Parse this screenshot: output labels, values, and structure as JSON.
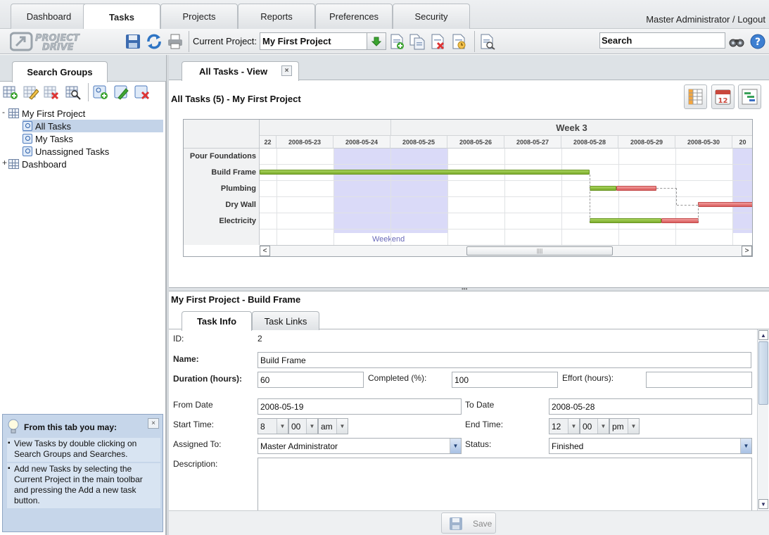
{
  "top_tabs": [
    "Dashboard",
    "Tasks",
    "Projects",
    "Reports",
    "Preferences",
    "Security"
  ],
  "user": {
    "link_text": "Master Administrator / Logout"
  },
  "brand": {
    "logo_line1": "PROJECT",
    "logo_line2": "DRIVE"
  },
  "toolbar": {
    "current_project_label": "Current Project:",
    "current_project_value": "My First Project",
    "search_value": "Search",
    "icons": [
      "save-icon",
      "refresh-icon",
      "print-icon",
      "add-task-icon",
      "copy-task-icon",
      "delete-task-icon",
      "schedule-task-icon",
      "report-icon",
      "binoculars-icon",
      "help-icon"
    ]
  },
  "left_panel": {
    "tab": "Search Groups",
    "tools": [
      "add-group-icon",
      "edit-group-icon",
      "delete-group-icon",
      "view-group-icon",
      "add-search-icon",
      "edit-search-icon",
      "delete-search-icon"
    ],
    "tree": [
      {
        "label": "My First Project",
        "toggle": "-"
      },
      {
        "label": "All Tasks"
      },
      {
        "label": "My Tasks"
      },
      {
        "label": "Unassigned Tasks"
      },
      {
        "label": "Dashboard",
        "toggle": "+"
      }
    ]
  },
  "tips": {
    "title": "From this tab you may:",
    "close": "×",
    "items": [
      "View Tasks by double clicking on Search Groups and Searches.",
      "Add new Tasks by selecting the Current Project in the main toolbar and pressing the Add a new task button."
    ]
  },
  "main_tab": {
    "label": "All Tasks - View",
    "close": "×"
  },
  "view": {
    "title": "All Tasks (5) - My First Project"
  },
  "gantt": {
    "week_label": "Week 3",
    "partial_left_date": "22",
    "dates": [
      "2008-05-23",
      "2008-05-24",
      "2008-05-25",
      "2008-05-26",
      "2008-05-27",
      "2008-05-28",
      "2008-05-29",
      "2008-05-30"
    ],
    "partial_right_date": "20",
    "tasks": [
      "Pour Foundations",
      "Build Frame",
      "Plumbing",
      "Dry Wall",
      "Electricity"
    ],
    "weekend_label": "Weekend",
    "scroll_left": "<",
    "scroll_right": ">",
    "thumb_grip": "||||"
  },
  "detail": {
    "title": "My First Project - Build Frame",
    "tabs": [
      "Task Info",
      "Task Links"
    ]
  },
  "form": {
    "id_label": "ID:",
    "id_value": "2",
    "name_label": "Name:",
    "name_value": "Build Frame",
    "duration_label": "Duration (hours):",
    "duration_value": "60",
    "completed_label": "Completed (%):",
    "completed_value": "100",
    "effort_label": "Effort (hours):",
    "effort_value": "",
    "from_label": "From Date",
    "from_value": "2008-05-19",
    "to_label": "To Date",
    "to_value": "2008-05-28",
    "start_label": "Start Time:",
    "start_hour": "8",
    "start_min": "00",
    "start_ampm": "am",
    "end_label": "End Time:",
    "end_hour": "12",
    "end_min": "00",
    "end_ampm": "pm",
    "assigned_label": "Assigned To:",
    "assigned_value": "Master Administrator",
    "status_label": "Status:",
    "status_value": "Finished",
    "description_label": "Description:",
    "description_value": ""
  },
  "footer": {
    "save_label": "Save"
  },
  "colors": {
    "done": "#7cab2c",
    "remaining": "#d95c5c",
    "weekend": "#dadaf8",
    "selection": "#c3d3e8",
    "tips_bg": "#c6d6ea"
  }
}
